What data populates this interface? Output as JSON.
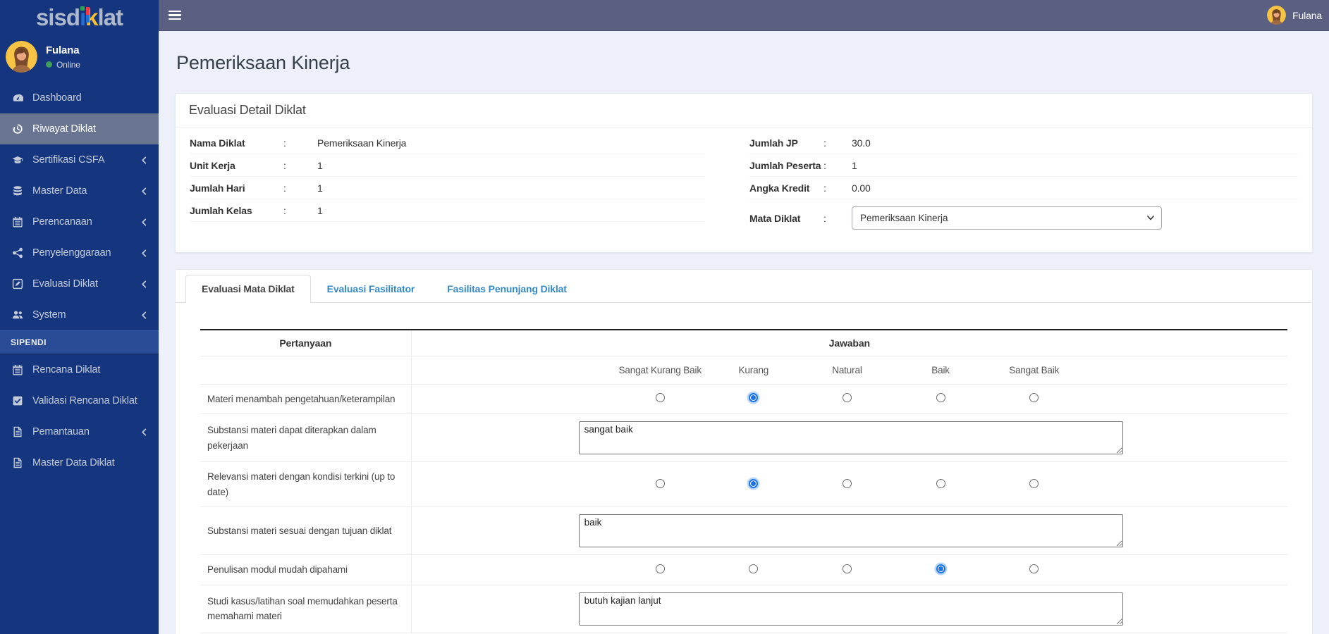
{
  "brand": {
    "name": "sisdiklat",
    "seg1": "sisd",
    "seg2": "ı",
    "seg3": "k",
    "seg4": "lat"
  },
  "colors": {
    "sidebar_bg": "#15357e",
    "sidebar_active_bg": "#6a7591",
    "section_bg": "#2a4c96",
    "topbar_bg": "#5b6083",
    "content_bg": "#edf0f8",
    "tab_link_blue": "#3389c9",
    "radio_selected_blue": "#1a73e8",
    "online_green": "#3f9e57",
    "logo_green": "#2ea84f",
    "logo_blue": "#1f6fd6",
    "logo_red": "#ef3a45",
    "logo_yellow": "#fbc02d"
  },
  "sidebar": {
    "user": {
      "name": "Fulana",
      "status": "Online",
      "avatar": "woman-avatar"
    },
    "items": [
      {
        "label": "Dashboard",
        "icon": "gauge-icon",
        "active": false,
        "has_submenu": false
      },
      {
        "label": "Riwayat Diklat",
        "icon": "history-icon",
        "active": true,
        "has_submenu": false
      },
      {
        "label": "Sertifikasi CSFA",
        "icon": "graduation-cap-icon",
        "active": false,
        "has_submenu": true
      },
      {
        "label": "Master Data",
        "icon": "database-icon",
        "active": false,
        "has_submenu": true
      },
      {
        "label": "Perencanaan",
        "icon": "calendar-icon",
        "active": false,
        "has_submenu": true
      },
      {
        "label": "Penyelenggaraan",
        "icon": "share-nodes-icon",
        "active": false,
        "has_submenu": true
      },
      {
        "label": "Evaluasi Diklat",
        "icon": "pen-square-icon",
        "active": false,
        "has_submenu": true
      },
      {
        "label": "System",
        "icon": "users-icon",
        "active": false,
        "has_submenu": true
      }
    ],
    "section_label": "SIPENDI",
    "section_items": [
      {
        "label": "Rencana Diklat",
        "icon": "calendar-icon",
        "active": false,
        "has_submenu": false
      },
      {
        "label": "Validasi Rencana Diklat",
        "icon": "check-square-icon",
        "active": false,
        "has_submenu": false
      },
      {
        "label": "Pemantauan",
        "icon": "file-icon",
        "active": false,
        "has_submenu": true
      },
      {
        "label": "Master Data Diklat",
        "icon": "file-icon",
        "active": false,
        "has_submenu": false
      }
    ]
  },
  "topbar": {
    "user_name": "Fulana"
  },
  "page": {
    "title": "Pemeriksaan Kinerja"
  },
  "detail_card": {
    "title": "Evaluasi Detail Diklat",
    "colon": ":",
    "left_rows": [
      {
        "label": "Nama Diklat",
        "value": "Pemeriksaan Kinerja"
      },
      {
        "label": "Unit Kerja",
        "value": "1"
      },
      {
        "label": "Jumlah Hari",
        "value": "1"
      },
      {
        "label": "Jumlah Kelas",
        "value": "1"
      }
    ],
    "right_rows": [
      {
        "label": "Jumlah JP",
        "value": "30.0"
      },
      {
        "label": "Jumlah Peserta",
        "value": "1"
      },
      {
        "label": "Angka Kredit",
        "value": "0.00"
      }
    ],
    "select_row": {
      "label": "Mata Diklat",
      "value": "Pemeriksaan Kinerja"
    }
  },
  "tabs": [
    {
      "label": "Evaluasi Mata Diklat",
      "active": true
    },
    {
      "label": "Evaluasi Fasilitator",
      "active": false
    },
    {
      "label": "Fasilitas Penunjang Diklat",
      "active": false
    }
  ],
  "evaluation": {
    "col_pertanyaan": "Pertanyaan",
    "col_jawaban": "Jawaban",
    "ratings": [
      "Sangat Kurang Baik",
      "Kurang",
      "Natural",
      "Baik",
      "Sangat Baik"
    ],
    "rows": [
      {
        "type": "radio",
        "question": "Materi menambah pengetahuan/keterampilan",
        "selected": "Kurang",
        "selected_index": 1
      },
      {
        "type": "text",
        "question": "Substansi materi dapat diterapkan dalam pekerjaan",
        "value": "sangat baik"
      },
      {
        "type": "radio",
        "question": "Relevansi materi dengan kondisi terkini (up to date)",
        "selected": "Kurang",
        "selected_index": 1
      },
      {
        "type": "text",
        "question": "Substansi materi sesuai dengan tujuan diklat",
        "value": "baik"
      },
      {
        "type": "radio",
        "question": "Penulisan modul mudah dipahami",
        "selected": "Baik",
        "selected_index": 3
      },
      {
        "type": "text",
        "question": "Studi kasus/latihan soal memudahkan peserta memahami materi",
        "value": "butuh kajian lanjut"
      }
    ]
  }
}
